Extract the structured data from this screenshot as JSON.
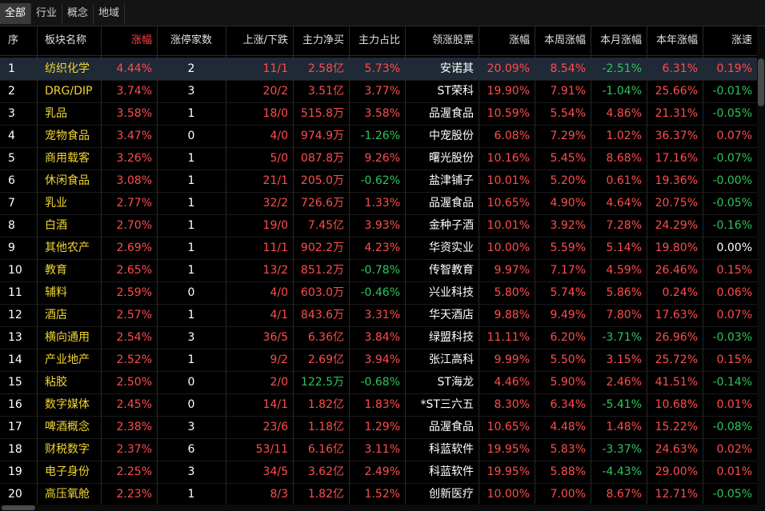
{
  "tabs": [
    "全部",
    "行业",
    "概念",
    "地域"
  ],
  "active_tab": 0,
  "columns": {
    "seq": "序",
    "name": "板块名称",
    "chg": "涨幅",
    "limitup": "涨停家数",
    "updown": "上涨/下跌",
    "netbuy": "主力净买",
    "ratio": "主力占比",
    "leader": "领涨股票",
    "leadchg": "涨幅",
    "week": "本周涨幅",
    "month": "本月涨幅",
    "year": "本年涨幅",
    "speed": "涨速"
  },
  "rows": [
    {
      "seq": "1",
      "name": "纺织化学",
      "chg": "4.44%",
      "limitup": "2",
      "updown": "11/1",
      "netbuy": "2.58亿",
      "ratio": "5.73%",
      "leader": "安诺其",
      "leadchg": "20.09%",
      "week": "8.54%",
      "month": "-2.51%",
      "year": "6.31%",
      "speed": "0.19%"
    },
    {
      "seq": "2",
      "name": "DRG/DIP",
      "chg": "3.74%",
      "limitup": "3",
      "updown": "20/2",
      "netbuy": "3.51亿",
      "ratio": "3.77%",
      "leader": "ST荣科",
      "leadchg": "19.90%",
      "week": "7.91%",
      "month": "-1.04%",
      "year": "25.66%",
      "speed": "-0.01%"
    },
    {
      "seq": "3",
      "name": "乳品",
      "chg": "3.58%",
      "limitup": "1",
      "updown": "18/0",
      "netbuy": "515.8万",
      "ratio": "3.58%",
      "leader": "品渥食品",
      "leadchg": "10.59%",
      "week": "5.54%",
      "month": "4.86%",
      "year": "21.31%",
      "speed": "-0.05%"
    },
    {
      "seq": "4",
      "name": "宠物食品",
      "chg": "3.47%",
      "limitup": "0",
      "updown": "4/0",
      "netbuy": "974.9万",
      "ratio": "-1.26%",
      "leader": "中宠股份",
      "leadchg": "6.08%",
      "week": "7.29%",
      "month": "1.02%",
      "year": "36.37%",
      "speed": "0.07%"
    },
    {
      "seq": "5",
      "name": "商用载客",
      "chg": "3.26%",
      "limitup": "1",
      "updown": "5/0",
      "netbuy": "087.8万",
      "ratio": "9.26%",
      "leader": "曙光股份",
      "leadchg": "10.16%",
      "week": "5.45%",
      "month": "8.68%",
      "year": "17.16%",
      "speed": "-0.07%"
    },
    {
      "seq": "6",
      "name": "休闲食品",
      "chg": "3.08%",
      "limitup": "1",
      "updown": "21/1",
      "netbuy": "205.0万",
      "ratio": "-0.62%",
      "leader": "盐津铺子",
      "leadchg": "10.01%",
      "week": "5.20%",
      "month": "0.61%",
      "year": "19.36%",
      "speed": "-0.00%"
    },
    {
      "seq": "7",
      "name": "乳业",
      "chg": "2.77%",
      "limitup": "1",
      "updown": "32/2",
      "netbuy": "726.6万",
      "ratio": "1.33%",
      "leader": "品渥食品",
      "leadchg": "10.65%",
      "week": "4.90%",
      "month": "4.64%",
      "year": "20.75%",
      "speed": "-0.05%"
    },
    {
      "seq": "8",
      "name": "白酒",
      "chg": "2.70%",
      "limitup": "1",
      "updown": "19/0",
      "netbuy": "7.45亿",
      "ratio": "3.93%",
      "leader": "金种子酒",
      "leadchg": "10.01%",
      "week": "3.92%",
      "month": "7.28%",
      "year": "24.29%",
      "speed": "-0.16%"
    },
    {
      "seq": "9",
      "name": "其他农产",
      "chg": "2.69%",
      "limitup": "1",
      "updown": "11/1",
      "netbuy": "902.2万",
      "ratio": "4.23%",
      "leader": "华资实业",
      "leadchg": "10.00%",
      "week": "5.59%",
      "month": "5.14%",
      "year": "19.80%",
      "speed": "0.00%"
    },
    {
      "seq": "10",
      "name": "教育",
      "chg": "2.65%",
      "limitup": "1",
      "updown": "13/2",
      "netbuy": "851.2万",
      "ratio": "-0.78%",
      "leader": "传智教育",
      "leadchg": "9.97%",
      "week": "7.17%",
      "month": "4.59%",
      "year": "26.46%",
      "speed": "0.15%"
    },
    {
      "seq": "11",
      "name": "辅料",
      "chg": "2.59%",
      "limitup": "0",
      "updown": "4/0",
      "netbuy": "603.0万",
      "ratio": "-0.46%",
      "leader": "兴业科技",
      "leadchg": "5.80%",
      "week": "5.74%",
      "month": "5.86%",
      "year": "0.24%",
      "speed": "0.06%"
    },
    {
      "seq": "12",
      "name": "酒店",
      "chg": "2.57%",
      "limitup": "1",
      "updown": "4/1",
      "netbuy": "843.6万",
      "ratio": "3.31%",
      "leader": "华天酒店",
      "leadchg": "9.88%",
      "week": "9.49%",
      "month": "7.80%",
      "year": "17.63%",
      "speed": "0.07%"
    },
    {
      "seq": "13",
      "name": "横向通用",
      "chg": "2.54%",
      "limitup": "3",
      "updown": "36/5",
      "netbuy": "6.36亿",
      "ratio": "3.84%",
      "leader": "绿盟科技",
      "leadchg": "11.11%",
      "week": "6.20%",
      "month": "-3.71%",
      "year": "26.96%",
      "speed": "-0.03%"
    },
    {
      "seq": "14",
      "name": "产业地产",
      "chg": "2.52%",
      "limitup": "1",
      "updown": "9/2",
      "netbuy": "2.69亿",
      "ratio": "3.94%",
      "leader": "张江高科",
      "leadchg": "9.99%",
      "week": "5.50%",
      "month": "3.15%",
      "year": "25.72%",
      "speed": "0.15%"
    },
    {
      "seq": "15",
      "name": "粘胶",
      "chg": "2.50%",
      "limitup": "0",
      "updown": "2/0",
      "netbuy": "122.5万",
      "ratio": "-0.68%",
      "leader": "ST海龙",
      "leadchg": "4.46%",
      "week": "5.90%",
      "month": "2.46%",
      "year": "41.51%",
      "speed": "-0.14%"
    },
    {
      "seq": "16",
      "name": "数字媒体",
      "chg": "2.45%",
      "limitup": "0",
      "updown": "14/1",
      "netbuy": "1.82亿",
      "ratio": "1.83%",
      "leader": "*ST三六五",
      "leadchg": "8.30%",
      "week": "6.34%",
      "month": "-5.41%",
      "year": "10.68%",
      "speed": "0.01%"
    },
    {
      "seq": "17",
      "name": "啤酒概念",
      "chg": "2.38%",
      "limitup": "3",
      "updown": "23/6",
      "netbuy": "1.18亿",
      "ratio": "1.29%",
      "leader": "品渥食品",
      "leadchg": "10.65%",
      "week": "4.48%",
      "month": "1.48%",
      "year": "15.22%",
      "speed": "-0.08%"
    },
    {
      "seq": "18",
      "name": "财税数字",
      "chg": "2.37%",
      "limitup": "6",
      "updown": "53/11",
      "netbuy": "6.16亿",
      "ratio": "3.11%",
      "leader": "科蓝软件",
      "leadchg": "19.95%",
      "week": "5.83%",
      "month": "-3.37%",
      "year": "24.63%",
      "speed": "0.02%"
    },
    {
      "seq": "19",
      "name": "电子身份",
      "chg": "2.25%",
      "limitup": "3",
      "updown": "34/5",
      "netbuy": "3.62亿",
      "ratio": "2.49%",
      "leader": "科蓝软件",
      "leadchg": "19.95%",
      "week": "5.88%",
      "month": "-4.43%",
      "year": "29.00%",
      "speed": "0.01%"
    },
    {
      "seq": "20",
      "name": "高压氧舱",
      "chg": "2.23%",
      "limitup": "1",
      "updown": "8/3",
      "netbuy": "1.82亿",
      "ratio": "1.52%",
      "leader": "创新医疗",
      "leadchg": "10.00%",
      "week": "7.00%",
      "month": "8.67%",
      "year": "12.71%",
      "speed": "-0.05%"
    }
  ],
  "colors": {
    "up": "#ff4d4d",
    "down": "#2ec55a",
    "name": "#f2d631",
    "selected_row": "#1f2a36"
  }
}
